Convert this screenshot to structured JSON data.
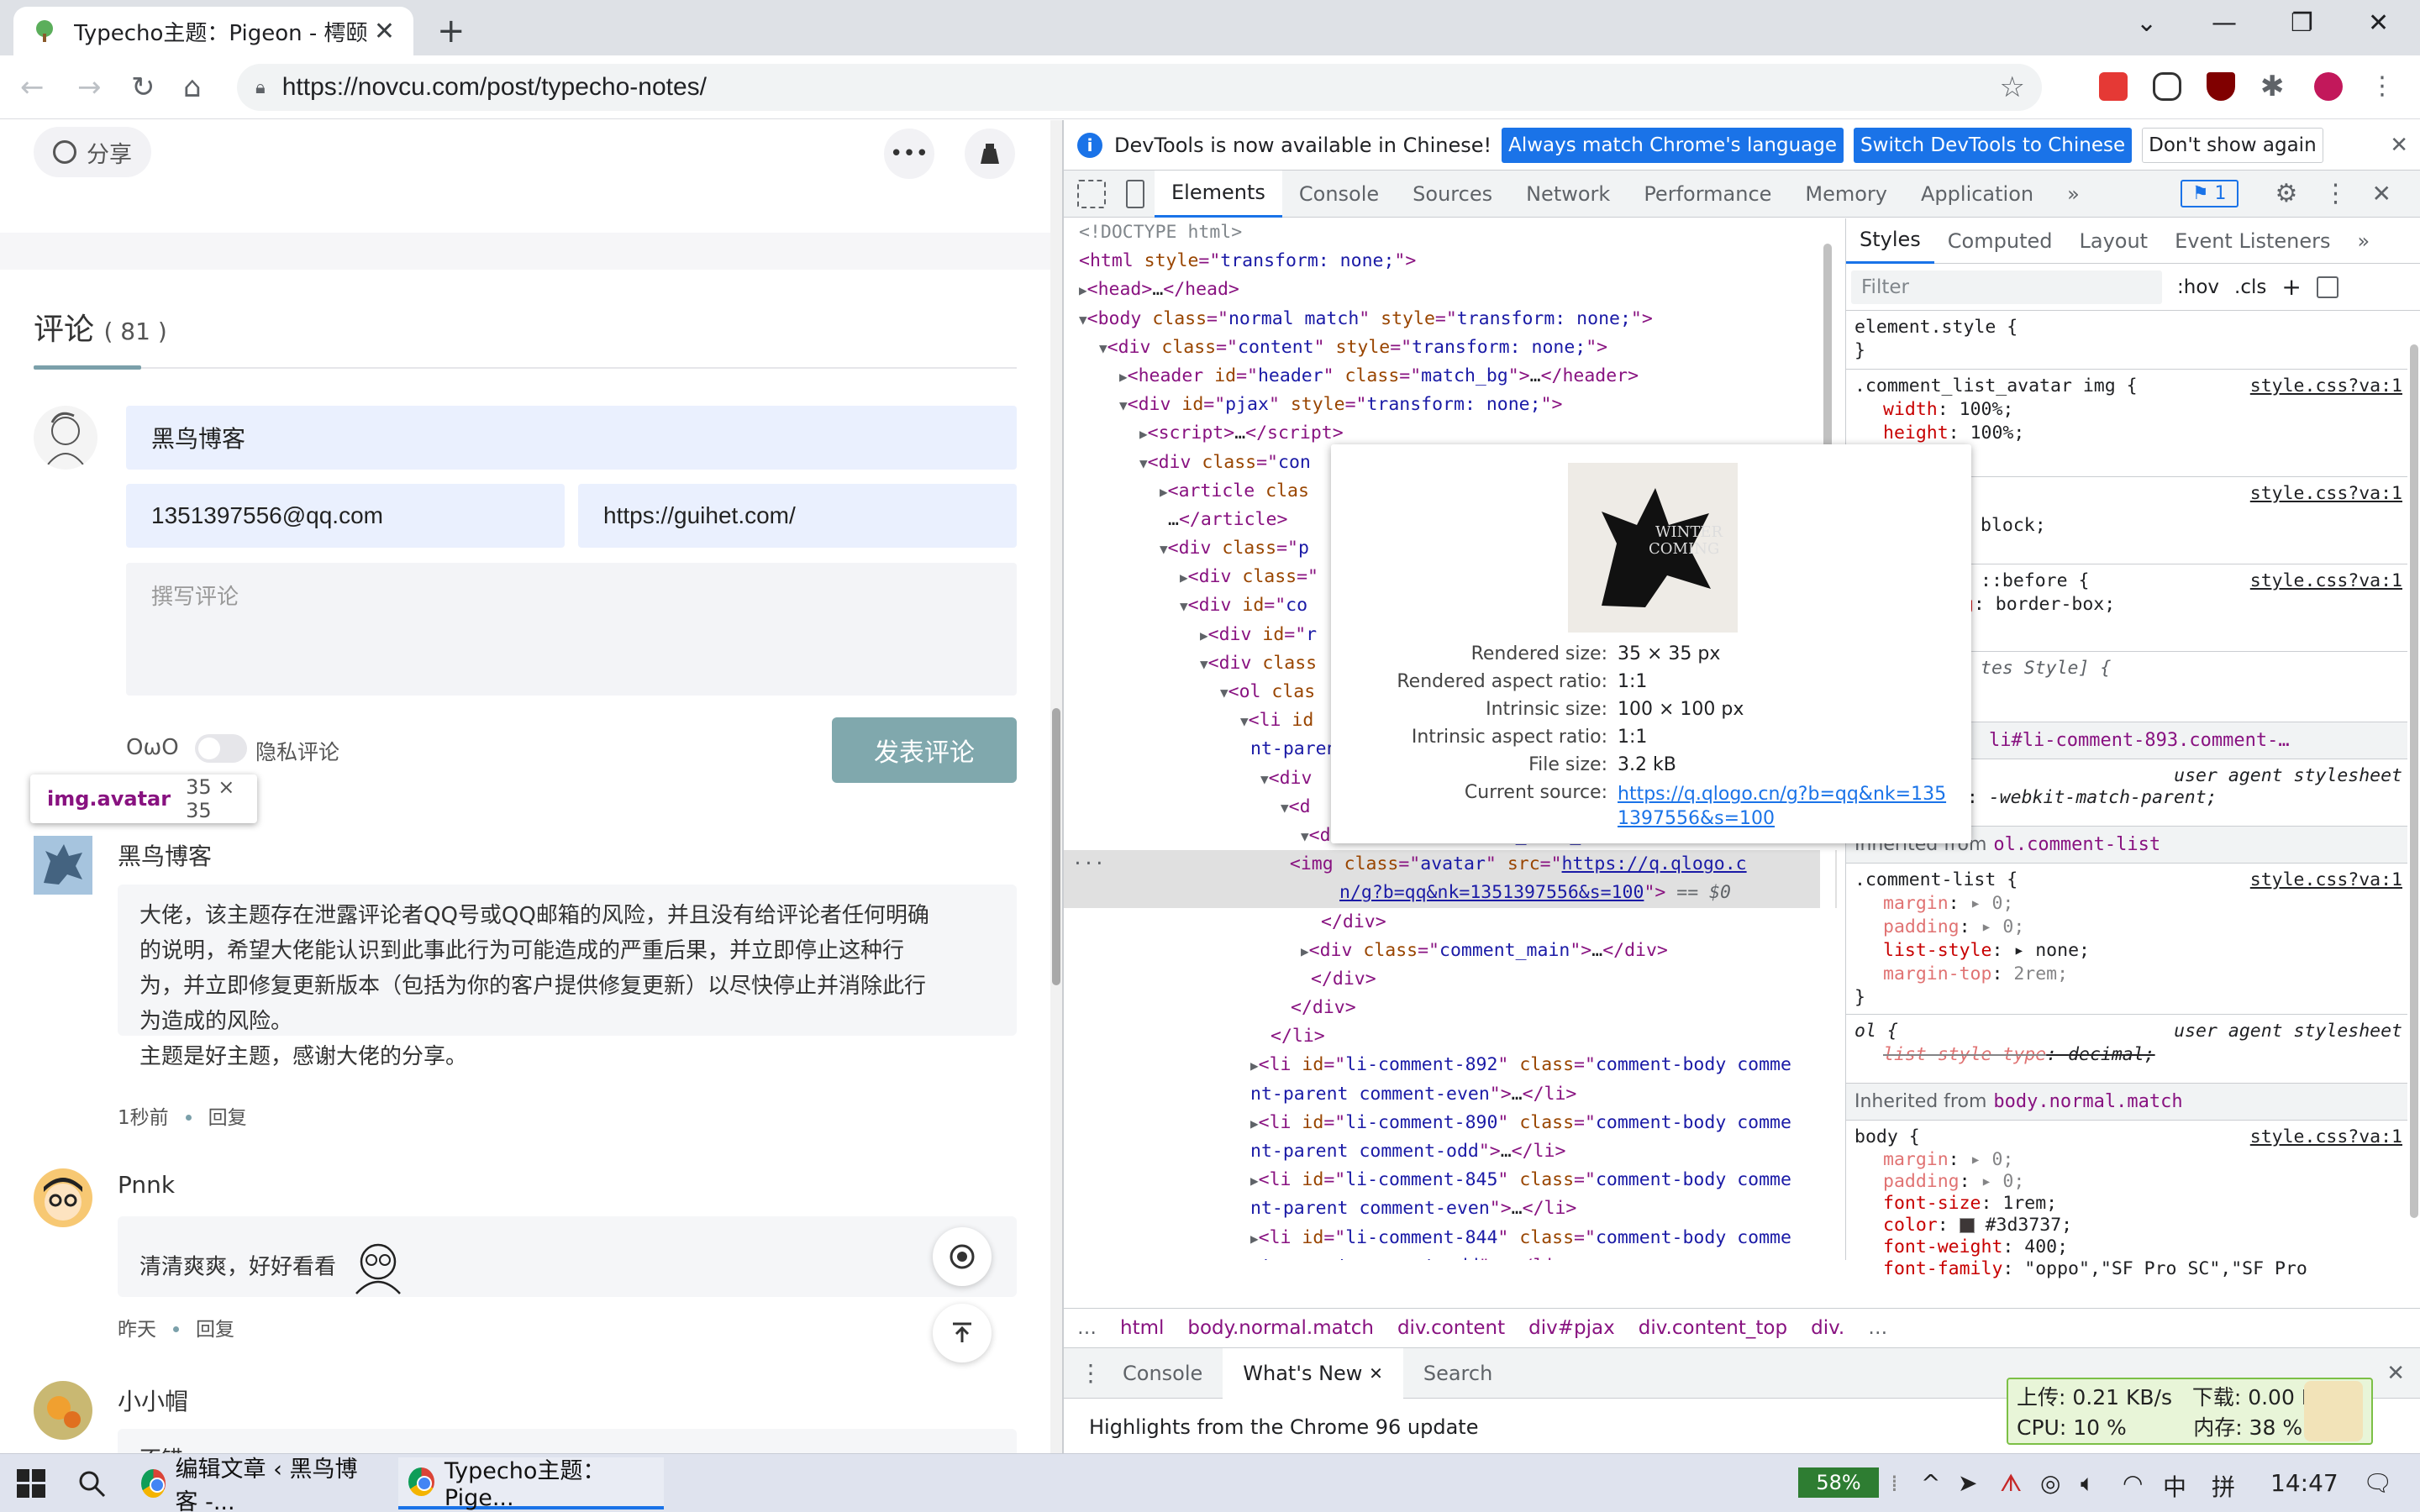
{
  "browser": {
    "tab_title": "Typecho主题：Pigeon - 樗颐",
    "tab_close": "✕",
    "new_tab": "+",
    "url": "https://novcu.com/post/typecho-notes/",
    "window_controls": [
      "⌄",
      "—",
      "❐",
      "✕"
    ]
  },
  "page": {
    "share_label": "分享",
    "more_label": "•••",
    "comments_title": "评论",
    "comments_count": "( 81 )",
    "form": {
      "name_value": "黑鸟博客",
      "email_value": "1351397556@qq.com",
      "website_value": "https://guihet.com/",
      "comment_placeholder": "撰写评论",
      "owo_label": "OωO",
      "private_label": "隐私评论",
      "submit_label": "发表评论"
    },
    "inspect_tip": {
      "tag": "img.avatar",
      "size": "35 × 35"
    },
    "comments": [
      {
        "author": "黑鸟博客",
        "lines": [
          "大佬，该主题存在泄露评论者QQ号或QQ邮箱的风险，并且没有给评论者任何明确",
          "的说明，希望大佬能认识到此事此行为可能造成的严重后果，并立即停止这种行",
          "为，并立即修复更新版本（包括为你的客户提供修复更新）以尽快停止并消除此行",
          "为造成的风险。",
          "主题是好主题，感谢大佬的分享。"
        ],
        "time": "1秒前",
        "reply": "回复"
      },
      {
        "author": "Pnnk",
        "lines": [
          "清清爽爽，好好看看"
        ],
        "time": "昨天",
        "reply": "回复"
      },
      {
        "author": "小小帽",
        "lines": [
          "不错"
        ],
        "time": "",
        "reply": ""
      }
    ]
  },
  "devtools": {
    "infobar": {
      "message": "DevTools is now available in Chinese!",
      "btn_match": "Always match Chrome's language",
      "btn_switch": "Switch DevTools to Chinese",
      "btn_dismiss": "Don't show again",
      "close": "✕"
    },
    "tabs": [
      "Elements",
      "Console",
      "Sources",
      "Network",
      "Performance",
      "Memory",
      "Application",
      "»"
    ],
    "issues_badge": "1",
    "styles_tabs": [
      "Styles",
      "Computed",
      "Layout",
      "Event Listeners",
      "»"
    ],
    "filter_placeholder": "Filter",
    "hov": ":hov",
    "cls": ".cls",
    "plus": "+",
    "popover": {
      "rendered_size_k": "Rendered size:",
      "rendered_size_v": "35 × 35 px",
      "rendered_ratio_k": "Rendered aspect ratio:",
      "rendered_ratio_v": "1:1",
      "intrinsic_size_k": "Intrinsic size:",
      "intrinsic_size_v": "100 × 100 px",
      "intrinsic_ratio_k": "Intrinsic aspect ratio:",
      "intrinsic_ratio_v": "1:1",
      "file_size_k": "File size:",
      "file_size_v": "3.2 kB",
      "source_k": "Current source:",
      "source_v": "https://q.qlogo.cn/g?b=qq&nk=1351397556&s=100"
    },
    "breadcrumbs": [
      "…",
      "html",
      "body.normal.match",
      "div.content",
      "div#pjax",
      "div.content_top",
      "div.",
      "…"
    ],
    "drawer_tabs": [
      "Console",
      "What's New",
      "Search"
    ],
    "drawer_close": "✕",
    "drawer_message": "Highlights from the Chrome 96 update",
    "styles": {
      "element_style": "element.style {",
      "rule1_selector": ".comment_list_avatar img {",
      "rule1_src": "style.css?va:1",
      "rule1_p1": "width",
      "rule1_v1": "100%;",
      "rule1_p2": "height",
      "rule1_v2": "100%;",
      "rule2_src": "style.css?va:1",
      "rule2_v": "block;",
      "rule3_src": "style.css?va:1",
      "rule3_sel": "::before {",
      "rule3_p": "ng",
      "rule3_v": "border-box;",
      "rule4_text": "tes Style] {",
      "ua_sel": "li#li-comment-893.comment-…",
      "ua_label": "user agent stylesheet",
      "ua_p": "gn",
      "ua_v": "-webkit-match-parent;",
      "inherited1_label": "Inherited from",
      "inherited1_el": "ol.comment-list",
      "cl_sel": ".comment-list {",
      "cl_src": "style.css?va:1",
      "cl_p1": "margin",
      "cl_v1": "▸ 0;",
      "cl_p2": "padding",
      "cl_v2": "▸ 0;",
      "cl_p3": "list-style",
      "cl_v3": "▸ none;",
      "cl_p4": "margin-top",
      "cl_v4": "2rem;",
      "ol_sel": "ol {",
      "ol_ua": "user agent stylesheet",
      "ol_p": "list-style-type",
      "ol_v": "decimal;",
      "inherited2_label": "Inherited from",
      "inherited2_el": "body.normal.match",
      "body_sel": "body {",
      "body_src": "style.css?va:1",
      "body_p1": "margin",
      "body_v1": "▸ 0;",
      "body_p2": "padding",
      "body_v2": "▸ 0;",
      "body_p3": "font-size",
      "body_v3": "1rem;",
      "body_p4": "color",
      "body_v4": "#3d3737;",
      "body_p5": "font-weight",
      "body_v5": "400;",
      "body_p6": "font-family",
      "body_v6": "\"oppo\",\"SF Pro SC\",\"SF Pro"
    }
  },
  "netmon": {
    "up": "上传: 0.21 KB/s",
    "down": "下载: 0.00 KB/s",
    "cpu": "CPU: 10 %",
    "mem": "内存: 38 %"
  },
  "taskbar": {
    "app1": "编辑文章 ‹ 黑鸟博客 -...",
    "app2": "Typecho主题：Pige...",
    "battery": "58%",
    "ime1": "中",
    "ime2": "拼",
    "time": "14:47"
  },
  "colors": {
    "accent": "#1a73e8",
    "submit": "#80a8ad",
    "tag": "#881280"
  }
}
